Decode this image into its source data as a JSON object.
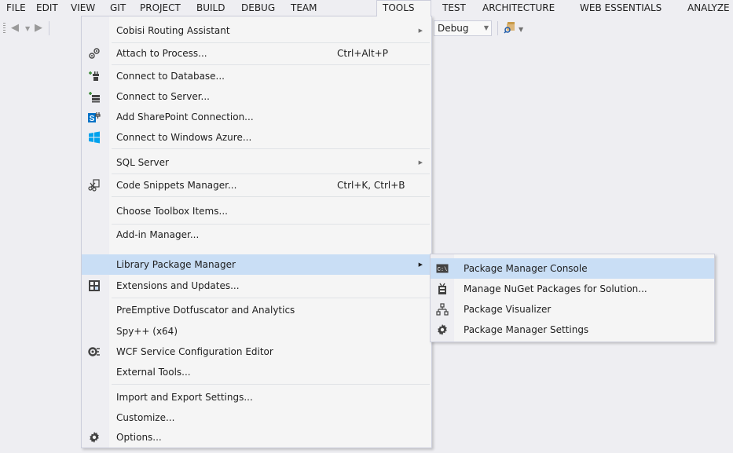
{
  "menubar": {
    "items": [
      {
        "label": "FILE"
      },
      {
        "label": "EDIT"
      },
      {
        "label": "VIEW"
      },
      {
        "label": "GIT"
      },
      {
        "label": "PROJECT"
      },
      {
        "label": "BUILD"
      },
      {
        "label": "DEBUG"
      },
      {
        "label": "TEAM"
      },
      {
        "label": "TOOLS"
      },
      {
        "label": "TEST"
      },
      {
        "label": "ARCHITECTURE"
      },
      {
        "label": "WEB ESSENTIALS"
      },
      {
        "label": "ANALYZE"
      }
    ],
    "active_index": 8
  },
  "toolbar": {
    "config_combo": "Debug"
  },
  "tools_menu": {
    "items": [
      {
        "label": "Cobisi Routing Assistant",
        "shortcut": "",
        "submenu": true,
        "icon": ""
      },
      {
        "label": "Attach to Process...",
        "shortcut": "Ctrl+Alt+P",
        "submenu": false,
        "icon": "attach-process-icon"
      },
      {
        "label": "Connect to Database...",
        "shortcut": "",
        "submenu": false,
        "icon": "connect-database-icon"
      },
      {
        "label": "Connect to Server...",
        "shortcut": "",
        "submenu": false,
        "icon": "connect-server-icon"
      },
      {
        "label": "Add SharePoint Connection...",
        "shortcut": "",
        "submenu": false,
        "icon": "sharepoint-icon"
      },
      {
        "label": "Connect to Windows Azure...",
        "shortcut": "",
        "submenu": false,
        "icon": "windows-azure-icon"
      },
      {
        "label": "SQL Server",
        "shortcut": "",
        "submenu": true,
        "icon": ""
      },
      {
        "label": "Code Snippets Manager...",
        "shortcut": "Ctrl+K, Ctrl+B",
        "submenu": false,
        "icon": "code-snippets-icon"
      },
      {
        "label": "Choose Toolbox Items...",
        "shortcut": "",
        "submenu": false,
        "icon": ""
      },
      {
        "label": "Add-in Manager...",
        "shortcut": "",
        "submenu": false,
        "icon": ""
      },
      {
        "label": "Library Package Manager",
        "shortcut": "",
        "submenu": true,
        "icon": "",
        "highlighted": true
      },
      {
        "label": "Extensions and Updates...",
        "shortcut": "",
        "submenu": false,
        "icon": "extensions-icon"
      },
      {
        "label": "PreEmptive Dotfuscator and Analytics",
        "shortcut": "",
        "submenu": false,
        "icon": ""
      },
      {
        "label": "Spy++ (x64)",
        "shortcut": "",
        "submenu": false,
        "icon": ""
      },
      {
        "label": "WCF Service Configuration Editor",
        "shortcut": "",
        "submenu": false,
        "icon": "wcf-config-icon"
      },
      {
        "label": "External Tools...",
        "shortcut": "",
        "submenu": false,
        "icon": ""
      },
      {
        "label": "Import and Export Settings...",
        "shortcut": "",
        "submenu": false,
        "icon": ""
      },
      {
        "label": "Customize...",
        "shortcut": "",
        "submenu": false,
        "icon": ""
      },
      {
        "label": "Options...",
        "shortcut": "",
        "submenu": false,
        "icon": "gear-icon"
      }
    ]
  },
  "package_submenu": {
    "items": [
      {
        "label": "Package Manager Console",
        "icon": "console-icon",
        "highlighted": true
      },
      {
        "label": "Manage NuGet Packages for Solution...",
        "icon": "nuget-packages-icon"
      },
      {
        "label": "Package Visualizer",
        "icon": "package-visualizer-icon"
      },
      {
        "label": "Package Manager Settings",
        "icon": "gear-icon"
      }
    ]
  }
}
